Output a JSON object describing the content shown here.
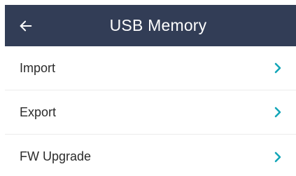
{
  "header": {
    "title": "USB Memory",
    "back_icon": "arrow-left-icon",
    "background": "#323d56",
    "text_color": "#ffffff"
  },
  "menu": {
    "chevron_icon": "chevron-right-icon",
    "chevron_color": "#14a6b8",
    "items": [
      {
        "label": "Import"
      },
      {
        "label": "Export"
      },
      {
        "label": "FW Upgrade"
      }
    ]
  }
}
